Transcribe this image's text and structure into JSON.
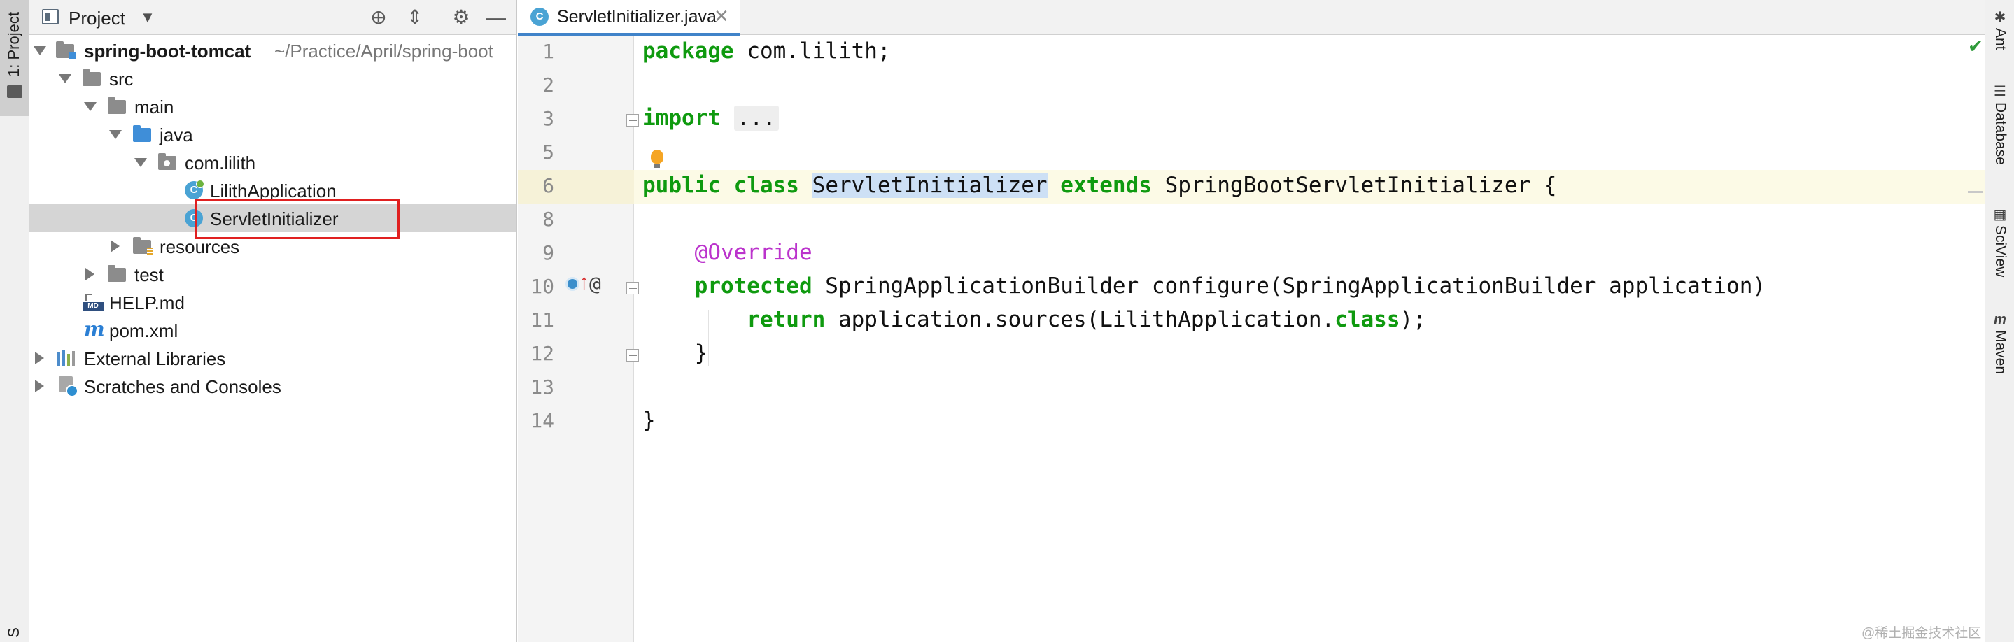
{
  "left_strip": {
    "project_tab": "1: Project",
    "bottom_tab": "S"
  },
  "project_panel": {
    "title": "Project",
    "tree": {
      "root_name": "spring-boot-tomcat",
      "root_path": "~/Practice/April/spring-boot",
      "src": "src",
      "main": "main",
      "java": "java",
      "package": "com.lilith",
      "class1": "LilithApplication",
      "class2": "ServletInitializer",
      "resources": "resources",
      "test": "test",
      "help": "HELP.md",
      "pom": "pom.xml",
      "external": "External Libraries",
      "scratches": "Scratches and Consoles"
    },
    "md_badge": "MD",
    "pom_glyph": "m",
    "class_glyph": "C"
  },
  "editor": {
    "tab_title": "ServletInitializer.java",
    "line_numbers": [
      "1",
      "2",
      "3",
      "5",
      "6",
      "8",
      "9",
      "10",
      "11",
      "12",
      "13",
      "14"
    ],
    "code": {
      "l1_kw": "package",
      "l1_rest": " com.lilith;",
      "l3_kw": "import",
      "l3_fold": "...",
      "l6_kw1": "public",
      "l6_kw2": "class",
      "l6_name": "ServletInitializer",
      "l6_kw3": "extends",
      "l6_rest": " SpringBootServletInitializer {",
      "l8_ann": "@Override",
      "l9_kw": "protected",
      "l9_rest": " SpringApplicationBuilder configure(SpringApplicationBuilder application)",
      "l10_kw": "return",
      "l10_mid": " application.sources(LilithApplication.",
      "l10_kw2": "class",
      "l10_end": ");",
      "l11": "}",
      "l13": "}"
    }
  },
  "right_strip": {
    "tools": [
      "Ant",
      "Database",
      "SciView",
      "Maven"
    ]
  },
  "watermark": "@稀土掘金技术社区",
  "colors": {
    "keyword": "#0f9a0f",
    "annotation": "#bb33cc",
    "selection_accent": "#4083c9",
    "highlight_box": "#e02020"
  }
}
